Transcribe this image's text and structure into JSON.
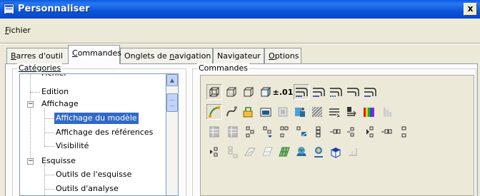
{
  "window": {
    "title": "Personnaliser",
    "close_label": "x"
  },
  "menu": {
    "file_first": "F",
    "file_rest": "ichier"
  },
  "tabs": [
    {
      "ul": "B",
      "rest": "arres d'outil"
    },
    {
      "ul": "C",
      "rest": "ommandes"
    },
    {
      "pre": "Onglets de ",
      "ul": "n",
      "rest": "avigation"
    },
    {
      "pre": "Navigateur",
      "ul": "",
      "rest": ""
    },
    {
      "ul": "O",
      "rest": "ptions"
    }
  ],
  "categories": {
    "label": "Catégories",
    "items": [
      {
        "label": "Fichier"
      },
      {
        "label": "Edition"
      },
      {
        "label": "Affichage"
      },
      {
        "label": "Affichage du modèle"
      },
      {
        "label": "Affichage des références"
      },
      {
        "label": "Visibilité"
      },
      {
        "label": "Esquisse"
      },
      {
        "label": "Outils de l'esquisse"
      },
      {
        "label": "Outils d'analyse"
      }
    ]
  },
  "commands": {
    "label": "Commandes",
    "rows": [
      [
        "box-wire-icon",
        "box-hidden-icon",
        "box-edges-icon",
        "box-shaded-icon",
        "tolerance-icon",
        "tangent-edge-1-icon",
        "tangent-edge-2-icon",
        "tangent-edge-3-icon",
        "tangent-edge-4-icon",
        "tangent-edge-5-icon"
      ],
      [
        "curve-spline-icon",
        "curve-freeform-icon",
        "part-color-icon",
        "display-state-icon",
        "model-tree-icon",
        "appearance-icon",
        "texture-icon",
        "shadow-icon",
        "reflect-icon",
        "color-bars-icon",
        "gradient-icon"
      ],
      [
        "grid-1-icon",
        "grid-2-icon",
        "feature-tree-1-icon",
        "feature-tree-2-icon",
        "feature-tree-3-icon",
        "feature-tree-4-icon",
        "feature-tree-5-icon",
        "feature-tree-6-icon",
        "feature-tree-7-icon",
        "feature-tree-8-icon",
        "feature-tree-9-icon",
        "feature-tree-10-icon"
      ],
      [
        "feature-tree-11-icon",
        "feature-tree-12-icon",
        "sketch-plane-icon",
        "surface-icon",
        "mesh-icon",
        "globe-icon",
        "user-icon",
        "cube-icon",
        "dimension-icon"
      ]
    ],
    "tolerance_text": "±.01"
  }
}
